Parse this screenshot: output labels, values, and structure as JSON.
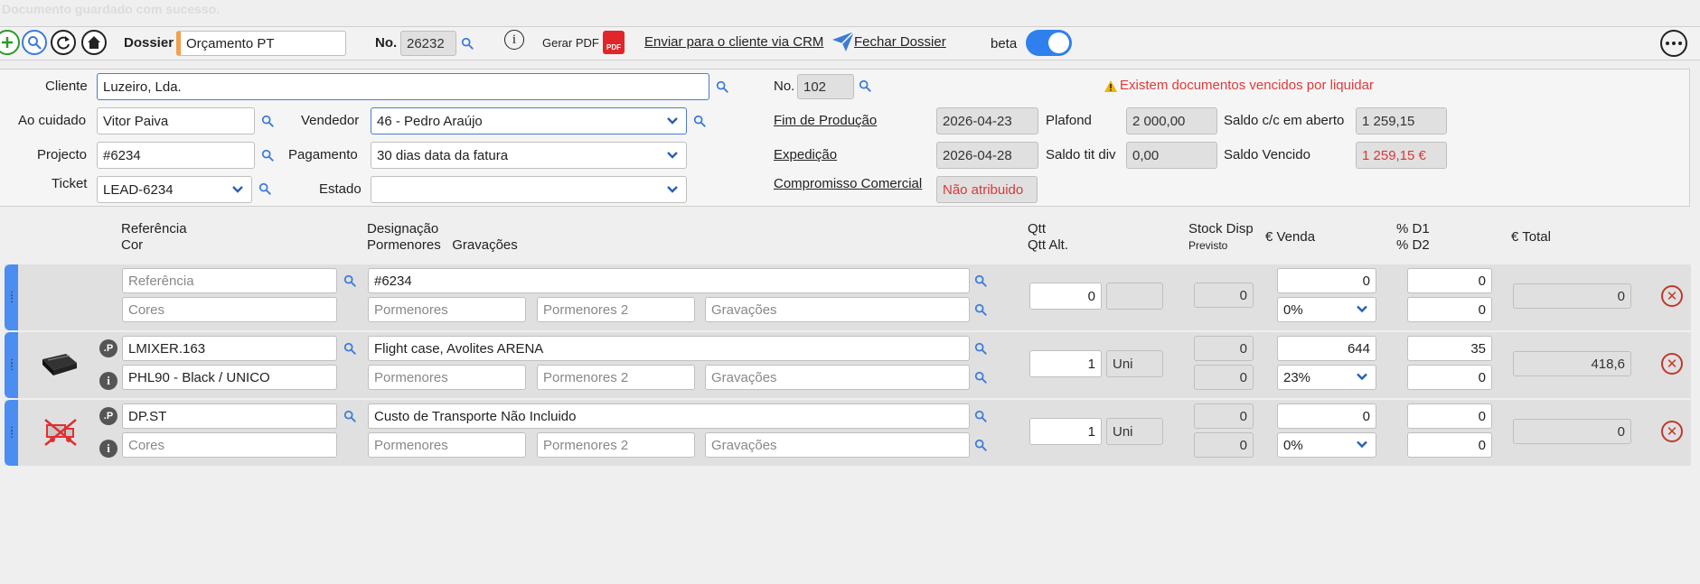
{
  "ghost_message": "Documento guardado com sucesso.",
  "toolbar": {
    "dossier_label": "Dossier",
    "dossier_value": "Orçamento PT",
    "no_label": "No.",
    "no_value": "26232",
    "pdf_label": "Gerar PDF",
    "pdf_icon_text": "PDF",
    "crm_link": "Enviar para o cliente via CRM",
    "close_link": "Fechar Dossier",
    "beta_label": "beta",
    "beta_on": true
  },
  "form": {
    "cliente_label": "Cliente",
    "cliente_value": "Luzeiro, Lda.",
    "ao_cuidado_label": "Ao cuidado",
    "ao_cuidado_value": "Vitor Paiva",
    "vendedor_label": "Vendedor",
    "vendedor_value": "46 - Pedro Araújo",
    "projecto_label": "Projecto",
    "projecto_value": "#6234",
    "pagamento_label": "Pagamento",
    "pagamento_value": "30 dias data da fatura",
    "ticket_label": "Ticket",
    "ticket_value": "LEAD-6234",
    "estado_label": "Estado",
    "estado_value": "",
    "no_label": "No.",
    "no_value": "102",
    "warning_text": "Existem documentos vencidos por liquidar",
    "fim_producao_label": "Fim de Produção",
    "fim_producao_value": "2026-04-23",
    "expedicao_label": "Expedição",
    "expedicao_value": "2026-04-28",
    "compromisso_label": "Compromisso Comercial",
    "compromisso_value": "Não atribuido",
    "plafond_label": "Plafond",
    "plafond_value": "2 000,00",
    "saldo_tit_label": "Saldo tit div",
    "saldo_tit_value": "0,00",
    "saldo_cc_label": "Saldo c/c em aberto",
    "saldo_cc_value": "1 259,15",
    "saldo_vencido_label": "Saldo Vencido",
    "saldo_vencido_value": "1 259,15 €"
  },
  "columns": {
    "referencia": "Referência",
    "cor": "Cor",
    "designacao": "Designação",
    "pormenores": "Pormenores",
    "gravacoes": "Gravações",
    "qtt": "Qtt",
    "qtt_alt": "Qtt Alt.",
    "stock_disp": "Stock Disp",
    "previsto": "Previsto",
    "venda": "€ Venda",
    "d1": "% D1",
    "d2": "% D2",
    "total": "€ Total"
  },
  "placeholders": {
    "referencia": "Referência",
    "cores": "Cores",
    "pormenores": "Pormenores",
    "pormenores2": "Pormenores 2",
    "gravacoes": "Gravações"
  },
  "rows": [
    {
      "referencia": "",
      "cor": "",
      "designacao": "#6234",
      "qtt": "0",
      "unit": "",
      "stock": "0",
      "previsto": "",
      "venda": "0",
      "iva": "0%",
      "d1": "0",
      "d2": "0",
      "total": "0",
      "badge_p": "",
      "badge_i": ""
    },
    {
      "referencia": "LMIXER.163",
      "cor": "PHL90 - Black / UNICO",
      "designacao": "Flight case, Avolites ARENA",
      "qtt": "1",
      "unit": "Uni",
      "stock": "0",
      "previsto": "0",
      "venda": "644",
      "iva": "23%",
      "d1": "35",
      "d2": "0",
      "total": "418,6",
      "badge_p": ".P",
      "badge_i": "i"
    },
    {
      "referencia": "DP.ST",
      "cor": "",
      "designacao": "Custo de Transporte Não Incluido",
      "qtt": "1",
      "unit": "Uni",
      "stock": "0",
      "previsto": "0",
      "venda": "0",
      "iva": "0%",
      "d1": "0",
      "d2": "0",
      "total": "0",
      "badge_p": ".P",
      "badge_i": "i"
    }
  ],
  "colors": {
    "accent": "#4b8df0",
    "warning": "#d63a3a",
    "delete": "#c0392b"
  }
}
